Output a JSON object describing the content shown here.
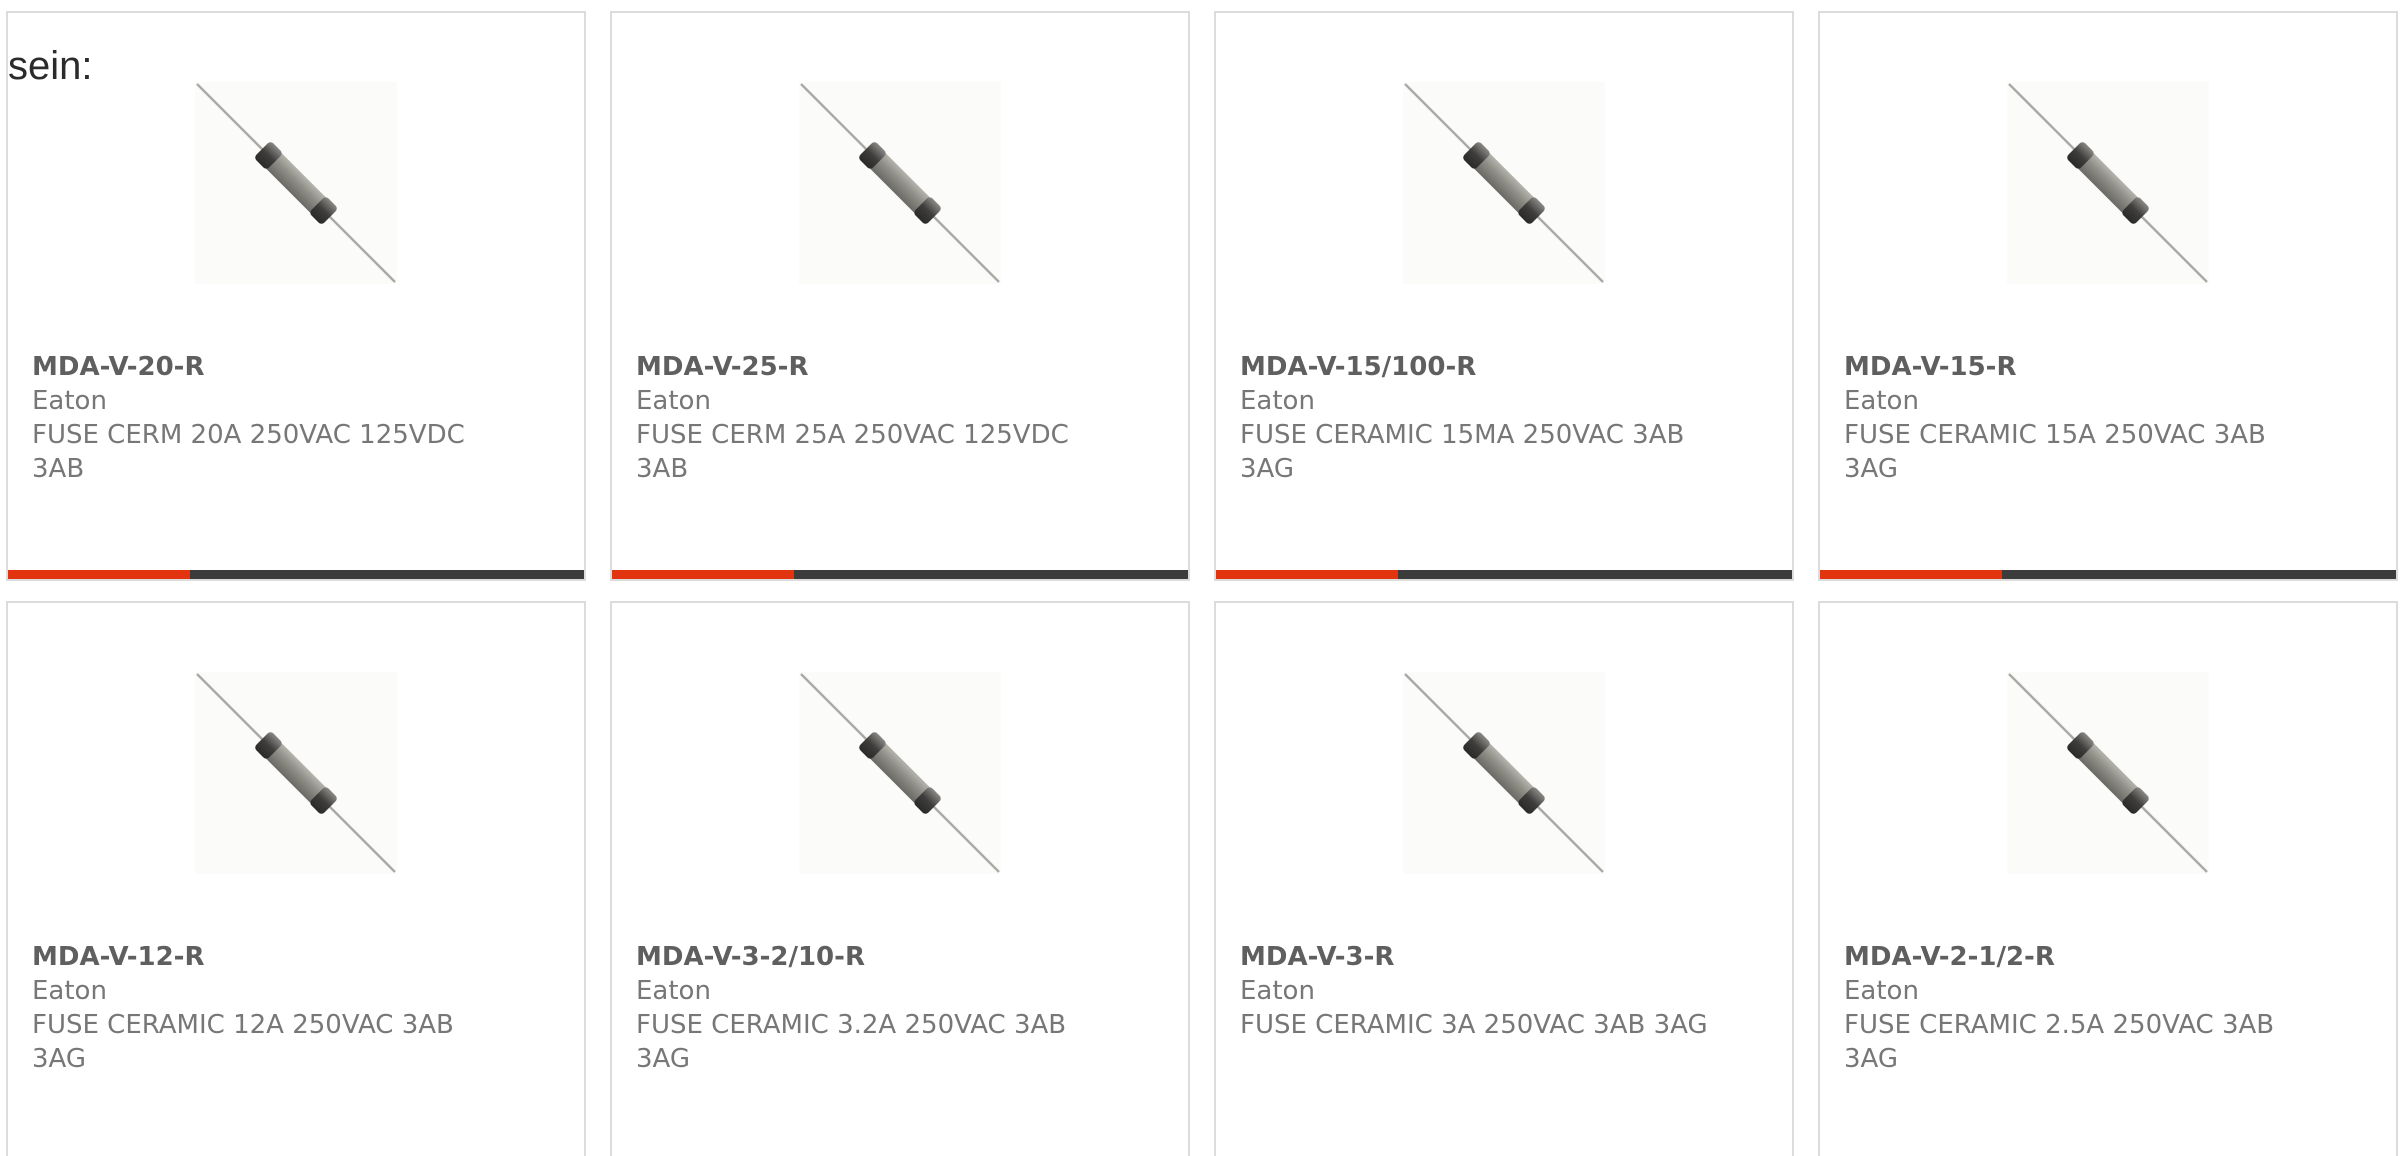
{
  "intro_text": "sein:",
  "accent_color": "#e2340f",
  "products": [
    {
      "part_number": "MDA-V-20-R",
      "manufacturer": "Eaton",
      "description": "FUSE CERM 20A 250VAC 125VDC 3AB",
      "image_icon": "ceramic-fuse-image"
    },
    {
      "part_number": "MDA-V-25-R",
      "manufacturer": "Eaton",
      "description": "FUSE CERM 25A 250VAC 125VDC 3AB",
      "image_icon": "ceramic-fuse-image"
    },
    {
      "part_number": "MDA-V-15/100-R",
      "manufacturer": "Eaton",
      "description": "FUSE CERAMIC 15MA 250VAC 3AB 3AG",
      "image_icon": "ceramic-fuse-image"
    },
    {
      "part_number": "MDA-V-15-R",
      "manufacturer": "Eaton",
      "description": "FUSE CERAMIC 15A 250VAC 3AB 3AG",
      "image_icon": "ceramic-fuse-image"
    },
    {
      "part_number": "MDA-V-12-R",
      "manufacturer": "Eaton",
      "description": "FUSE CERAMIC 12A 250VAC 3AB 3AG",
      "image_icon": "ceramic-fuse-image"
    },
    {
      "part_number": "MDA-V-3-2/10-R",
      "manufacturer": "Eaton",
      "description": "FUSE CERAMIC 3.2A 250VAC 3AB 3AG",
      "image_icon": "ceramic-fuse-image"
    },
    {
      "part_number": "MDA-V-3-R",
      "manufacturer": "Eaton",
      "description": "FUSE CERAMIC 3A 250VAC 3AB 3AG",
      "image_icon": "ceramic-fuse-image"
    },
    {
      "part_number": "MDA-V-2-1/2-R",
      "manufacturer": "Eaton",
      "description": "FUSE CERAMIC 2.5A 250VAC 3AB 3AG",
      "image_icon": "ceramic-fuse-image"
    }
  ]
}
